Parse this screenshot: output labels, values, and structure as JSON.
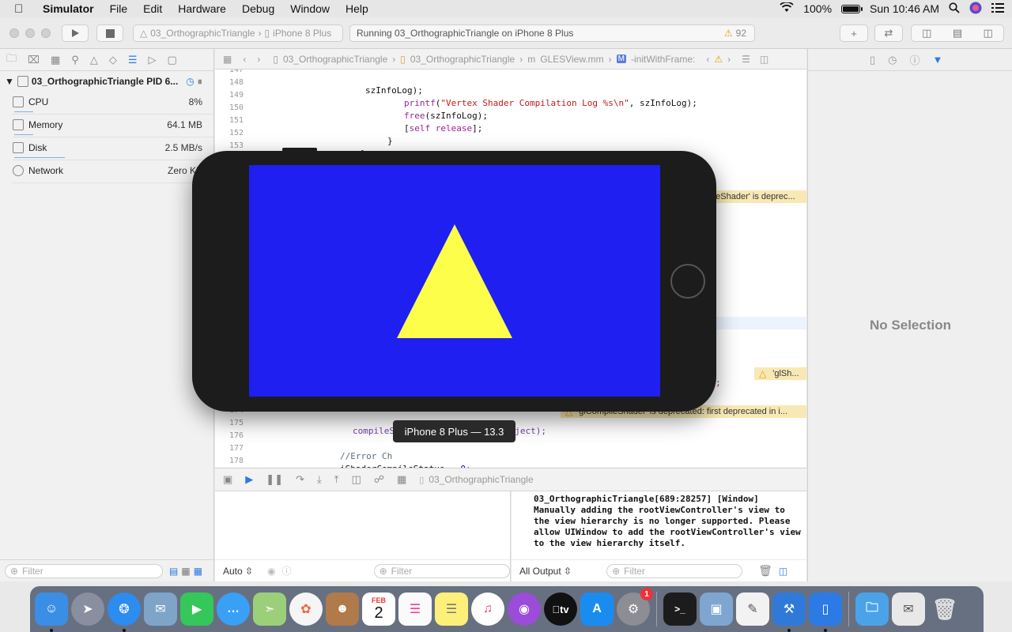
{
  "menubar": {
    "app": "Simulator",
    "items": [
      "File",
      "Edit",
      "Hardware",
      "Debug",
      "Window",
      "Help"
    ],
    "battery": "100%",
    "clock": "Sun 10:46 AM"
  },
  "toolbar": {
    "scheme_target": "03_OrthographicTriangle",
    "scheme_device": "iPhone 8 Plus",
    "activity": "Running 03_OrthographicTriangle on iPhone 8 Plus",
    "warning_count": "92"
  },
  "navigator": {
    "process": "03_OrthographicTriangle PID 6...",
    "gauges": [
      {
        "label": "CPU",
        "value": "8%"
      },
      {
        "label": "Memory",
        "value": "64.1 MB"
      },
      {
        "label": "Disk",
        "value": "2.5 MB/s"
      },
      {
        "label": "Network",
        "value": "Zero KB"
      }
    ],
    "filter_placeholder": "Filter"
  },
  "jumpbar": {
    "crumbs": [
      "03_OrthographicTriangle",
      "03_OrthographicTriangle",
      "GLESView.mm",
      "-initWithFrame:"
    ]
  },
  "code": {
    "lines": [
      {
        "num": "147",
        "text": "            szInfoLog);"
      },
      {
        "num": "148",
        "text": "            printf(\"Vertex Shader Compilation Log %s\\n\", szInfoLog);"
      },
      {
        "num": "149",
        "text": "            free(szInfoLog);"
      },
      {
        "num": "150",
        "text": "            [self release];"
      },
      {
        "num": "151",
        "text": "        }"
      },
      {
        "num": "152",
        "text": "    }"
      },
      {
        "num": "153",
        "text": "}"
      },
      {
        "num": "174",
        "text": "compileShader(gFragmentShaderObject);"
      },
      {
        "num": "175",
        "text": ""
      },
      {
        "num": "176",
        "text": "//Error Ch"
      },
      {
        "num": "177",
        "text": "iShaderCompileStatus = 0;"
      },
      {
        "num": "178",
        "text": "iInfoLogLength = 0;"
      }
    ],
    "issues": [
      "ateShader' is deprec...",
      "NULL);",
      "'glSh...",
      "glCompileShader' is deprecated: first deprecated in i..."
    ]
  },
  "debug": {
    "breadcrumb": "03_OrthographicTriangle",
    "variables_mode": "Auto",
    "filter_placeholder": "Filter",
    "output_mode": "All Output",
    "console_text": "03_OrthographicTriangle[689:28257] [Window] Manually adding the rootViewController's view to the view hierarchy is no longer supported. Please allow UIWindow to add the rootViewController's view to the view hierarchy itself."
  },
  "inspector": {
    "empty_text": "No Selection"
  },
  "simulator": {
    "tooltip": "iPhone 8 Plus — 13.3",
    "background_color": "#1e1ff0",
    "triangle_color": "#fdfe49"
  },
  "dock": {
    "calendar_month": "FEB",
    "calendar_day": "2",
    "tv_label": "tv",
    "prefs_badge": "1"
  }
}
